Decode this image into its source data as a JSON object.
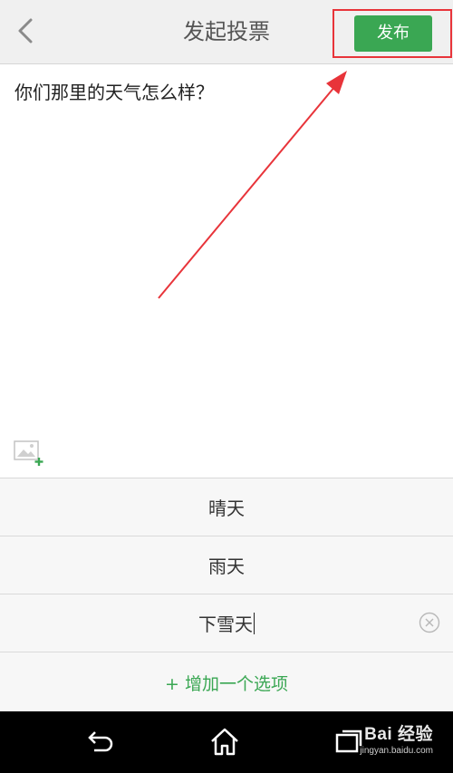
{
  "header": {
    "title": "发起投票",
    "publish_label": "发布"
  },
  "question": {
    "text": "你们那里的天气怎么样？"
  },
  "options": [
    {
      "label": "晴天"
    },
    {
      "label": "雨天"
    },
    {
      "label": "下雪天"
    }
  ],
  "add_option_label": "+ 增加一个选项",
  "watermark": {
    "brand": "Bai 经验",
    "url": "jingyan.baidu.com"
  },
  "icons": {
    "back": "chevron-left-icon",
    "image_add": "image-add-icon",
    "clear": "clear-circle-icon",
    "nav_back": "android-back-icon",
    "nav_home": "android-home-icon",
    "nav_recents": "android-recents-icon"
  },
  "colors": {
    "accent": "#3aa753",
    "annotation": "#e8343a",
    "header_bg": "#f0f0f0",
    "options_bg": "#f7f7f7",
    "navbar_bg": "#000000"
  }
}
